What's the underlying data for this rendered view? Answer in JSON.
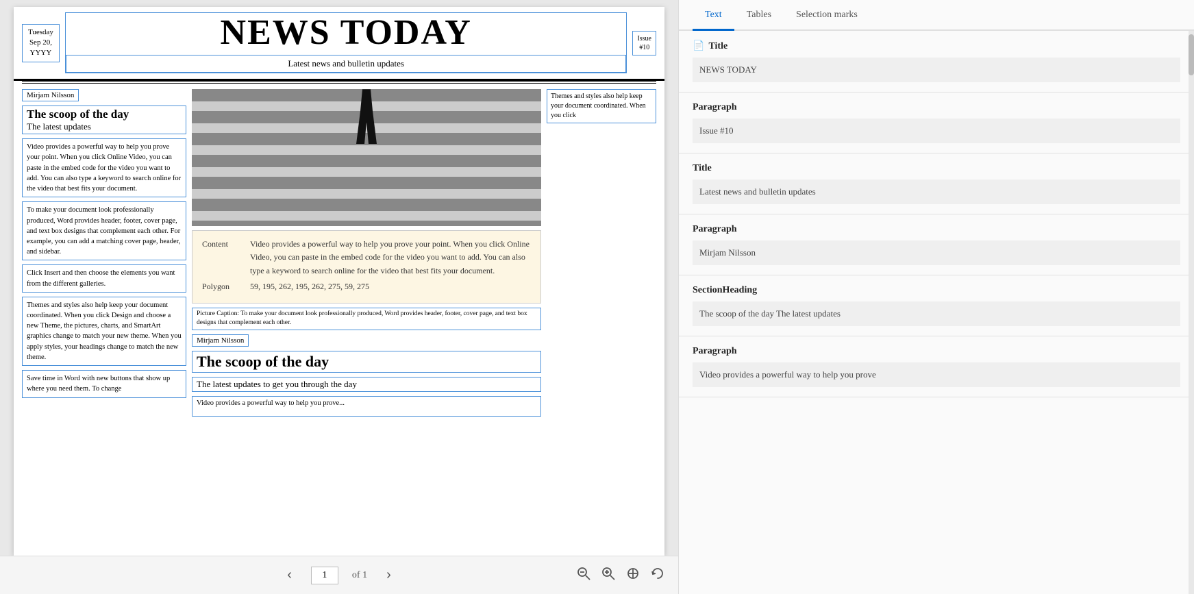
{
  "doc": {
    "date": "Tuesday\nSep 20,\nYYYY",
    "title": "NEWS TODAY",
    "subtitle": "Latest news and bulletin updates",
    "issue": "Issue\n#10",
    "left_col": {
      "author1": "Mirjam Nilsson",
      "heading1": "The scoop of the day",
      "subheading1": "The latest updates",
      "para1": "Video provides a powerful way to help you prove your point. When you click Online Video, you can paste in the embed code for the video you want to add. You can also type a keyword to search online for the video that best fits your document.",
      "para2": "To make your document look professionally produced, Word provides header, footer, cover page, and text box designs that complement each other. For example, you can add a matching cover page, header, and sidebar.",
      "para3": "Click Insert and then choose the elements you want from the different galleries.",
      "para4": "Themes and styles also help keep your document coordinated. When you click Design and choose a new Theme, the pictures, charts, and SmartArt graphics change to match your new theme. When you apply styles, your headings change to match the new theme.",
      "para5": "Save time in Word with new buttons that show up where you need them. To change"
    },
    "mid_col": {
      "tooltip_content_label": "Content",
      "tooltip_content_value": "Video provides a powerful way to help you prove your point. When you click Online Video, you can paste in the embed code for the video you want to add. You can also type a keyword to search online for the video that best fits your document.",
      "tooltip_polygon_label": "Polygon",
      "tooltip_polygon_value": "59, 195, 262, 195, 262, 275, 59, 275",
      "caption": "Picture Caption: To make your document look professionally produced, Word provides header, footer, cover page, and text box designs that complement each other.",
      "author2": "Mirjam Nilsson",
      "heading2": "The scoop of the day",
      "subheading2": "The latest updates to get you through the day",
      "para_bottom": "Video provides a powerful way to help you prove..."
    },
    "right_col": {
      "para1": "Themes and styles also help keep your document coordinated. When you click"
    },
    "nav": {
      "prev_label": "‹",
      "next_label": "›",
      "page_num": "1",
      "page_of": "of 1",
      "zoom_out": "🔍",
      "zoom_in": "🔍",
      "fit": "⊕",
      "rotate": "↺"
    }
  },
  "panel": {
    "tabs": [
      "Text",
      "Tables",
      "Selection marks"
    ],
    "active_tab": "Text",
    "sections": [
      {
        "type": "Title",
        "value": "NEWS TODAY"
      },
      {
        "type": "Paragraph",
        "value": "Issue #10"
      },
      {
        "type": "Title",
        "value": "Latest news and bulletin updates"
      },
      {
        "type": "Paragraph",
        "value": "Mirjam Nilsson"
      },
      {
        "type": "SectionHeading",
        "value": "The scoop of the day The latest updates"
      },
      {
        "type": "Paragraph",
        "value": "Video provides a powerful way to help you prove"
      }
    ]
  }
}
